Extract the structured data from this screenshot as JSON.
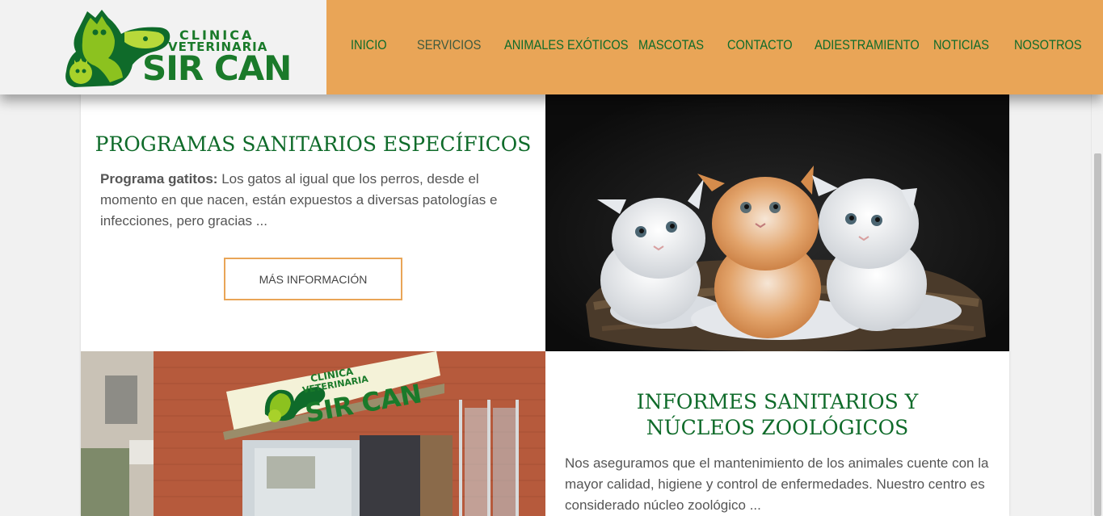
{
  "logo": {
    "line1": "CLINICA",
    "line2": "VETERINARIA",
    "line3": "SIR CAN"
  },
  "nav": {
    "items": [
      {
        "label": "INICIO",
        "active": false
      },
      {
        "label": "SERVICIOS",
        "active": true
      },
      {
        "label": "ANIMALES EXÓTICOS",
        "active": false
      },
      {
        "label": "MASCOTAS",
        "active": false
      },
      {
        "label": "CONTACTO",
        "active": false
      },
      {
        "label": "ADIESTRAMIENTO",
        "active": false
      },
      {
        "label": "NOTICIAS",
        "active": false
      },
      {
        "label": "NOSOTROS",
        "active": false
      }
    ]
  },
  "card1": {
    "title": "PROGRAMAS SANITARIOS ESPECÍFICOS",
    "lead": "Programa gatitos:",
    "text": " Los gatos al igual que los perros, desde el momento en que nacen, están expuestos a diversas patologías e infecciones, pero gracias ...",
    "button": "MÁS INFORMACIÓN"
  },
  "card2": {
    "title": "INFORMES SANITARIOS Y NÚCLEOS ZOOLÓGICOS",
    "text": "Nos aseguramos que el mantenimiento de los animales cuente con la mayor calidad, higiene y control de enfermedades. Nuestro centro es considerado núcleo zoológico ..."
  },
  "storefront": {
    "sign_line1": "CLINICA",
    "sign_line2": "VETERINARIA",
    "sign_line3": "SIR CAN"
  },
  "colors": {
    "brand_green": "#0f6b2a",
    "nav_orange": "#e9a557",
    "logo_lime": "#8cc21f"
  }
}
